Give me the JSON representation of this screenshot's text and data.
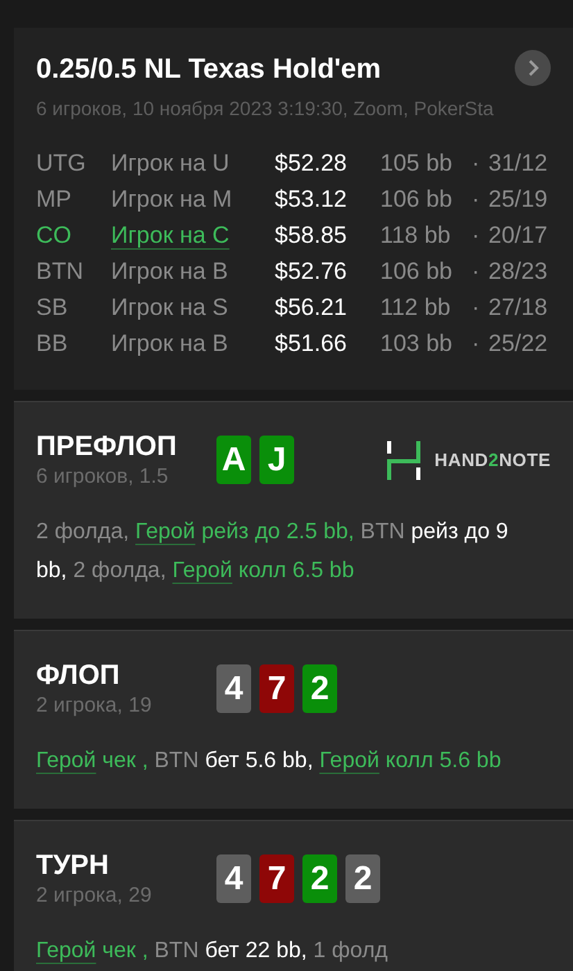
{
  "header": {
    "title": "0.25/0.5 NL Texas Hold'em",
    "subtitle": "6 игроков, 10 ноября 2023 3:19:30, Zoom, PokerSta"
  },
  "players": [
    {
      "position": "UTG",
      "name": "Игрок на U",
      "stack": "$52.28",
      "bb": "105 bb",
      "separator": "·",
      "stats": "31/12",
      "hero": false
    },
    {
      "position": "MP",
      "name": "Игрок на M",
      "stack": "$53.12",
      "bb": "106 bb",
      "separator": "·",
      "stats": "25/19",
      "hero": false
    },
    {
      "position": "CO",
      "name": "Игрок на C",
      "stack": "$58.85",
      "bb": "118 bb",
      "separator": "·",
      "stats": "20/17",
      "hero": true
    },
    {
      "position": "BTN",
      "name": "Игрок на B",
      "stack": "$52.76",
      "bb": "106 bb",
      "separator": "·",
      "stats": "28/23",
      "hero": false
    },
    {
      "position": "SB",
      "name": "Игрок на S",
      "stack": "$56.21",
      "bb": "112 bb",
      "separator": "·",
      "stats": "27/18",
      "hero": false
    },
    {
      "position": "BB",
      "name": "Игрок на B",
      "stack": "$51.66",
      "bb": "103 bb",
      "separator": "·",
      "stats": "25/22",
      "hero": false
    }
  ],
  "streets": [
    {
      "name": "ПРЕФЛОП",
      "info": "6 игроков, 1.5",
      "logo": {
        "before": "HAND",
        "accent": "2",
        "after": "NOTE"
      },
      "cards": [
        {
          "rank": "A",
          "color": "#0a8f0a"
        },
        {
          "rank": "J",
          "color": "#0a8f0a"
        }
      ],
      "actions": [
        {
          "kind": "plain",
          "text": "2 фолда, "
        },
        {
          "kind": "hero",
          "text": "Герой"
        },
        {
          "kind": "hero_action",
          "text": " рейз до 2.5 bb, "
        },
        {
          "kind": "plain",
          "text": "BTN "
        },
        {
          "kind": "action",
          "text": "рейз до 9 bb,"
        },
        {
          "kind": "plain",
          "text": " 2 фолда, "
        },
        {
          "kind": "hero",
          "text": "Герой"
        },
        {
          "kind": "hero_action",
          "text": " колл 6.5 bb"
        }
      ]
    },
    {
      "name": "ФЛОП",
      "info": "2 игрока, 19",
      "cards": [
        {
          "rank": "4",
          "color": "#5e5e5e"
        },
        {
          "rank": "7",
          "color": "#8f0707"
        },
        {
          "rank": "2",
          "color": "#0a8f0a"
        }
      ],
      "actions": [
        {
          "kind": "hero",
          "text": "Герой"
        },
        {
          "kind": "hero_action",
          "text": " чек , "
        },
        {
          "kind": "plain",
          "text": "BTN "
        },
        {
          "kind": "action",
          "text": "бет 5.6 bb, "
        },
        {
          "kind": "hero",
          "text": "Герой"
        },
        {
          "kind": "hero_action",
          "text": " колл 5.6 bb"
        }
      ]
    },
    {
      "name": "ТУРН",
      "info": "2 игрока, 29",
      "cards": [
        {
          "rank": "4",
          "color": "#5e5e5e"
        },
        {
          "rank": "7",
          "color": "#8f0707"
        },
        {
          "rank": "2",
          "color": "#0a8f0a"
        },
        {
          "rank": "2",
          "color": "#5e5e5e"
        }
      ],
      "actions": [
        {
          "kind": "hero",
          "text": "Герой"
        },
        {
          "kind": "hero_action",
          "text": " чек , "
        },
        {
          "kind": "plain",
          "text": "BTN "
        },
        {
          "kind": "action",
          "text": "бет 22 bb,"
        },
        {
          "kind": "plain",
          "text": " 1 фолд"
        }
      ]
    }
  ]
}
